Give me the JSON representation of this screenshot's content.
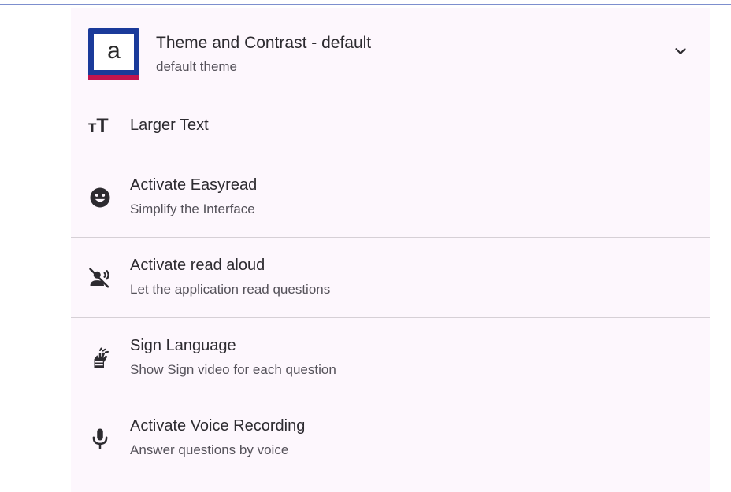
{
  "theme": {
    "thumb_letter": "a",
    "title": "Theme and Contrast - default",
    "subtitle": "default theme",
    "thumb_colors": {
      "frame": "#1a3a9a",
      "bar": "#c2144f"
    }
  },
  "options": [
    {
      "icon": "text-size-icon",
      "title": "Larger Text",
      "subtitle": ""
    },
    {
      "icon": "smiley-face-icon",
      "title": "Activate Easyread",
      "subtitle": "Simplify the Interface"
    },
    {
      "icon": "voice-off-icon",
      "title": "Activate read aloud",
      "subtitle": "Let the application read questions"
    },
    {
      "icon": "sign-language-icon",
      "title": "Sign Language",
      "subtitle": "Show Sign video for each question"
    },
    {
      "icon": "microphone-icon",
      "title": "Activate Voice Recording",
      "subtitle": "Answer questions by voice"
    }
  ],
  "colors": {
    "panel_bg": "#fdf7fd",
    "divider": "#d6d0d6",
    "text_primary": "#2d2b30",
    "text_secondary": "#55525a"
  }
}
